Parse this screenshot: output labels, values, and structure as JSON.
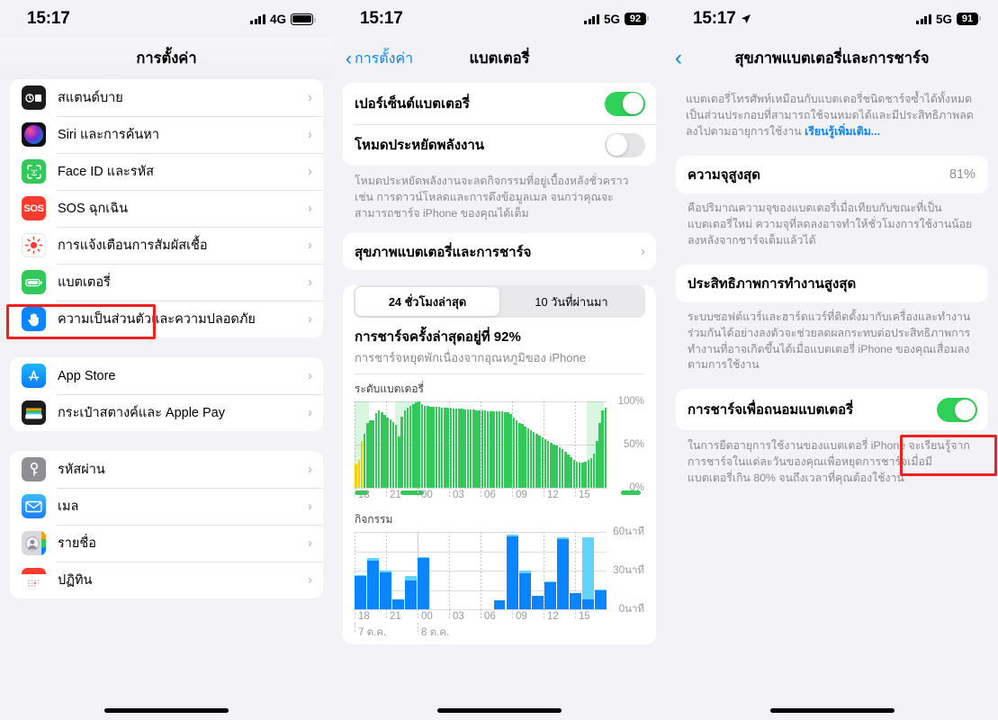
{
  "panel1": {
    "status": {
      "time": "15:17",
      "network": "4G",
      "battery_icon": "battery-full-icon"
    },
    "nav": {
      "title": "การตั้งค่า"
    },
    "groups": [
      {
        "items": [
          {
            "label": "สแตนด์บาย",
            "icon": "standby-icon"
          },
          {
            "label": "Siri และการค้นหา",
            "icon": "siri-icon"
          },
          {
            "label": "Face ID และรหัส",
            "icon": "faceid-icon"
          },
          {
            "label": "SOS ฉุกเฉิน",
            "icon": "sos-icon"
          },
          {
            "label": "การแจ้งเตือนการสัมผัสเชื้อ",
            "icon": "exposure-notification-icon"
          },
          {
            "label": "แบตเตอรี่",
            "icon": "battery-icon"
          },
          {
            "label": "ความเป็นส่วนตัวและความปลอดภัย",
            "icon": "privacy-hand-icon"
          }
        ]
      },
      {
        "items": [
          {
            "label": "App Store",
            "icon": "appstore-icon"
          },
          {
            "label": "กระเป๋าสตางค์และ Apple Pay",
            "icon": "wallet-icon"
          }
        ]
      },
      {
        "items": [
          {
            "label": "รหัสผ่าน",
            "icon": "passwords-key-icon"
          },
          {
            "label": "เมล",
            "icon": "mail-icon"
          },
          {
            "label": "รายชื่อ",
            "icon": "contacts-icon"
          },
          {
            "label": "ปฏิทิน",
            "icon": "calendar-icon"
          }
        ]
      }
    ]
  },
  "panel2": {
    "status": {
      "time": "15:17",
      "network": "5G",
      "battery_percent": "92"
    },
    "nav": {
      "back_label": "การตั้งค่า",
      "title": "แบตเตอรี่"
    },
    "toggles": [
      {
        "label": "เปอร์เซ็นต์แบตเตอรี่",
        "state": "on"
      },
      {
        "label": "โหมดประหยัดพลังงาน",
        "state": "off"
      }
    ],
    "footnote": "โหมดประหยัดพลังงานจะลดกิจกรรมที่อยู่เบื้องหลังชั่วคราว เช่น การดาวน์โหลดและการดึงข้อมูลเมล จนกว่าคุณจะสามารถชาร์จ iPhone ของคุณได้เต็ม",
    "health_row": {
      "label": "สุขภาพแบตเตอรี่และการชาร์จ"
    },
    "segmented": {
      "options": [
        "24 ชั่วโมงล่าสุด",
        "10 วันที่ผ่านมา"
      ],
      "selected": 0
    },
    "charge_title": "การชาร์จครั้งล่าสุดอยู่ที่ 92%",
    "charge_sub": "การชาร์จหยุดพักเนื่องจากอุณหภูมิของ iPhone",
    "battery_chart_label": "ระดับแบตเตอรี่",
    "activity_chart_label": "กิจกรรม"
  },
  "panel3": {
    "status": {
      "time": "15:17",
      "network": "5G",
      "battery_percent": "91",
      "location_icon": "location-arrow-icon"
    },
    "nav": {
      "title": "สุขภาพแบตเตอรี่และการชาร์จ"
    },
    "intro": "แบตเตอรี่โทรศัพท์เหมือนกับแบตเตอรี่ชนิดชาร์จซ้ำได้ทั้งหมดเป็นส่วนประกอบที่สามารถใช้จนหมดได้และมีประสิทธิภาพลดลงไปตามอายุการใช้งาน ",
    "intro_link": "เรียนรู้เพิ่มเติม...",
    "capacity": {
      "label": "ความจุสูงสุด",
      "value": "81%"
    },
    "capacity_footnote": "คือปริมาณความจุของแบตเตอรี่เมื่อเทียบกับขณะที่เป็นแบตเตอรี่ใหม่ ความจุที่ลดลงอาจทำให้ชั่วโมงการใช้งานน้อยลงหลังจากชาร์จเต็มแล้วได้",
    "performance": {
      "label": "ประสิทธิภาพการทำงานสูงสุด"
    },
    "performance_footnote": "ระบบซอฟต์แวร์และฮาร์ดแวร์ที่ติดตั้งมากับเครื่องและทำงานร่วมกันได้อย่างลงตัวจะช่วยลดผลกระทบต่อประสิทธิภาพการทำงานที่อาจเกิดขึ้นได้เมื่อแบตเตอรี่ iPhone ของคุณเสื่อมลงตามการใช้งาน",
    "optimized": {
      "label": "การชาร์จเพื่อถนอมแบตเตอรี่",
      "state": "on"
    },
    "optimized_footnote": "ในการยืดอายุการใช้งานของแบตเตอรี่ iPhone จะเรียนรู้จากการชาร์จในแต่ละวันของคุณเพื่อหยุดการชาร์จเมื่อมีแบตเตอรี่เกิน 80% จนถึงเวลาที่คุณต้องใช้งาน"
  },
  "colors": {
    "accent_blue": "#0a84ff",
    "green": "#30d158",
    "chart_green": "#34c759",
    "chart_yellow": "#ffcc00",
    "chart_blue": "#0a84ff",
    "chart_lightblue": "#64d2ff",
    "highlight_red": "#ef2020",
    "bg": "#f2f2f7"
  },
  "chart_data": [
    {
      "type": "bar",
      "title": "ระดับแบตเตอรี่",
      "xlabel": "",
      "ylabel": "",
      "ylim": [
        0,
        100
      ],
      "ytick_labels": [
        "100%",
        "50%",
        "0%"
      ],
      "ytick_values": [
        100,
        50,
        0
      ],
      "xtick_labels": [
        "18",
        "21",
        "00",
        "03",
        "06",
        "09",
        "12",
        "15"
      ],
      "grid": true,
      "legend": "none",
      "series": [
        {
          "name": "battery level",
          "values": [
            28,
            33,
            55,
            63,
            76,
            79,
            79,
            87,
            90,
            88,
            85,
            82,
            80,
            77,
            73,
            60,
            83,
            90,
            93,
            95,
            97,
            99,
            100,
            97,
            95,
            95,
            94,
            94,
            94,
            94,
            93,
            93,
            93,
            93,
            92,
            92,
            92,
            92,
            91,
            91,
            91,
            91,
            90,
            90,
            90,
            90,
            89,
            89,
            89,
            89,
            89,
            89,
            88,
            88,
            86,
            82,
            79,
            76,
            74,
            71,
            69,
            67,
            65,
            63,
            61,
            59,
            57,
            55,
            53,
            51,
            49,
            47,
            45,
            42,
            39,
            36,
            33,
            31,
            30,
            30,
            31,
            33,
            35,
            40,
            55,
            75,
            90,
            93
          ]
        }
      ],
      "bar_colors": [
        "yellow",
        "yellow",
        "yellow",
        "green"
      ],
      "yellow_bar_count": 3,
      "charging_shaded_ranges": [
        [
          0,
          5
        ],
        [
          14,
          21
        ],
        [
          81,
          87
        ]
      ],
      "charging_indicator_segments": [
        [
          0,
          4
        ],
        [
          14,
          21
        ],
        [
          81,
          87
        ]
      ]
    },
    {
      "type": "bar",
      "title": "กิจกรรม",
      "xlabel": "",
      "ylabel": "",
      "ylim": [
        0,
        60
      ],
      "ytick_labels": [
        "60นาที",
        "30นาที",
        "0นาที"
      ],
      "ytick_values": [
        60,
        30,
        0
      ],
      "xtick_labels": [
        "18",
        "21",
        "00",
        "03",
        "06",
        "09",
        "12",
        "15"
      ],
      "xdate_labels": [
        "7 ต.ค.",
        "8 ต.ค."
      ],
      "grid": true,
      "legend": "none",
      "series": [
        {
          "name": "screen on",
          "values": [
            26,
            38,
            29,
            8,
            23,
            40,
            0,
            0,
            0,
            0,
            0,
            7,
            57,
            28,
            11,
            21,
            55,
            13,
            7,
            15
          ]
        },
        {
          "name": "screen off",
          "values": [
            1,
            2,
            1,
            0,
            3,
            1,
            0,
            0,
            0,
            0,
            0,
            0,
            1,
            2,
            0,
            1,
            1,
            0,
            48,
            1
          ]
        }
      ]
    }
  ]
}
